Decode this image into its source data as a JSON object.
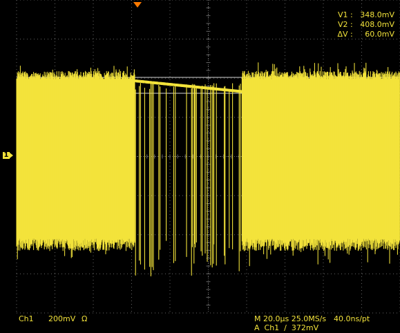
{
  "display": {
    "trigger_marker_icon": "trigger-marker-icon",
    "channel_ref_icon": "channel-ref-icon",
    "colors": {
      "background": "#000000",
      "grid": "#666666",
      "trace": "#f3e33b",
      "marker": "#ff7a00",
      "cursor_line": "#d9d9d9"
    }
  },
  "cursor_readout": {
    "v1_label": "V1 :",
    "v1_value": "348.0mV",
    "v2_label": "V2 :",
    "v2_value": "408.0mV",
    "dv_label": "ΔV :",
    "dv_value": "60.0mV"
  },
  "footer": {
    "channel": "Ch1",
    "scale": "200mV",
    "impedance": "Ω",
    "timebase": "M 20.0μs 25.0MS/s",
    "sample_interval": "40.0ns/pt",
    "trigger": "A  Ch1  ∕  372mV"
  },
  "channel_ref": {
    "label": "1"
  }
}
